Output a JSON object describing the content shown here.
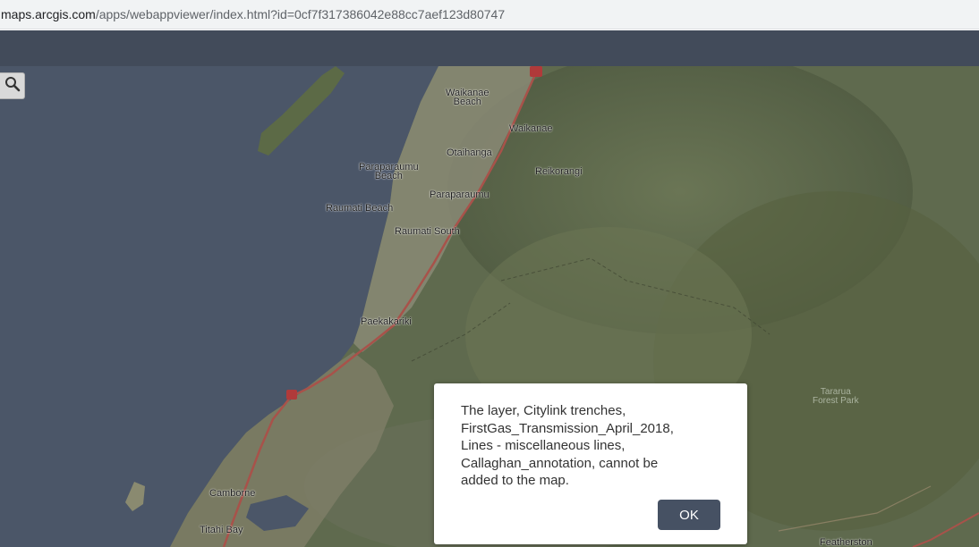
{
  "browser": {
    "url_host": "maps.arcgis.com",
    "url_path": "/apps/webappviewer/index.html?id=0cf7f317386042e88cc7aef123d80747"
  },
  "header": {
    "title": ""
  },
  "toolbar": {
    "search_icon": "search-icon"
  },
  "map": {
    "labels": {
      "waikanae_beach": "Waikanae\nBeach",
      "waikanae": "Waikanae",
      "otaihanga": "Otaihanga",
      "reikorangi": "Reikorangi",
      "paraparaumu_beach": "Paraparaumu\nBeach",
      "paraparaumu": "Paraparaumu",
      "raumati_beach": "Raumati Beach",
      "raumati_south": "Raumati South",
      "paekakariki": "Paekakariki",
      "camborne": "Camborne",
      "titahi_bay": "Titahi Bay",
      "featherston": "Featherston",
      "tararua_forest_park": "Tararua\nForest Park"
    },
    "colors": {
      "sea": "#4b5668",
      "land": "#5f6a4e",
      "road": "#a8524a"
    }
  },
  "dialog": {
    "message": "The layer, Citylink trenches,\nFirstGas_Transmission_April_2018,\nLines - miscellaneous lines,\nCallaghan_annotation, cannot be\nadded to the map.",
    "ok_label": "OK"
  }
}
